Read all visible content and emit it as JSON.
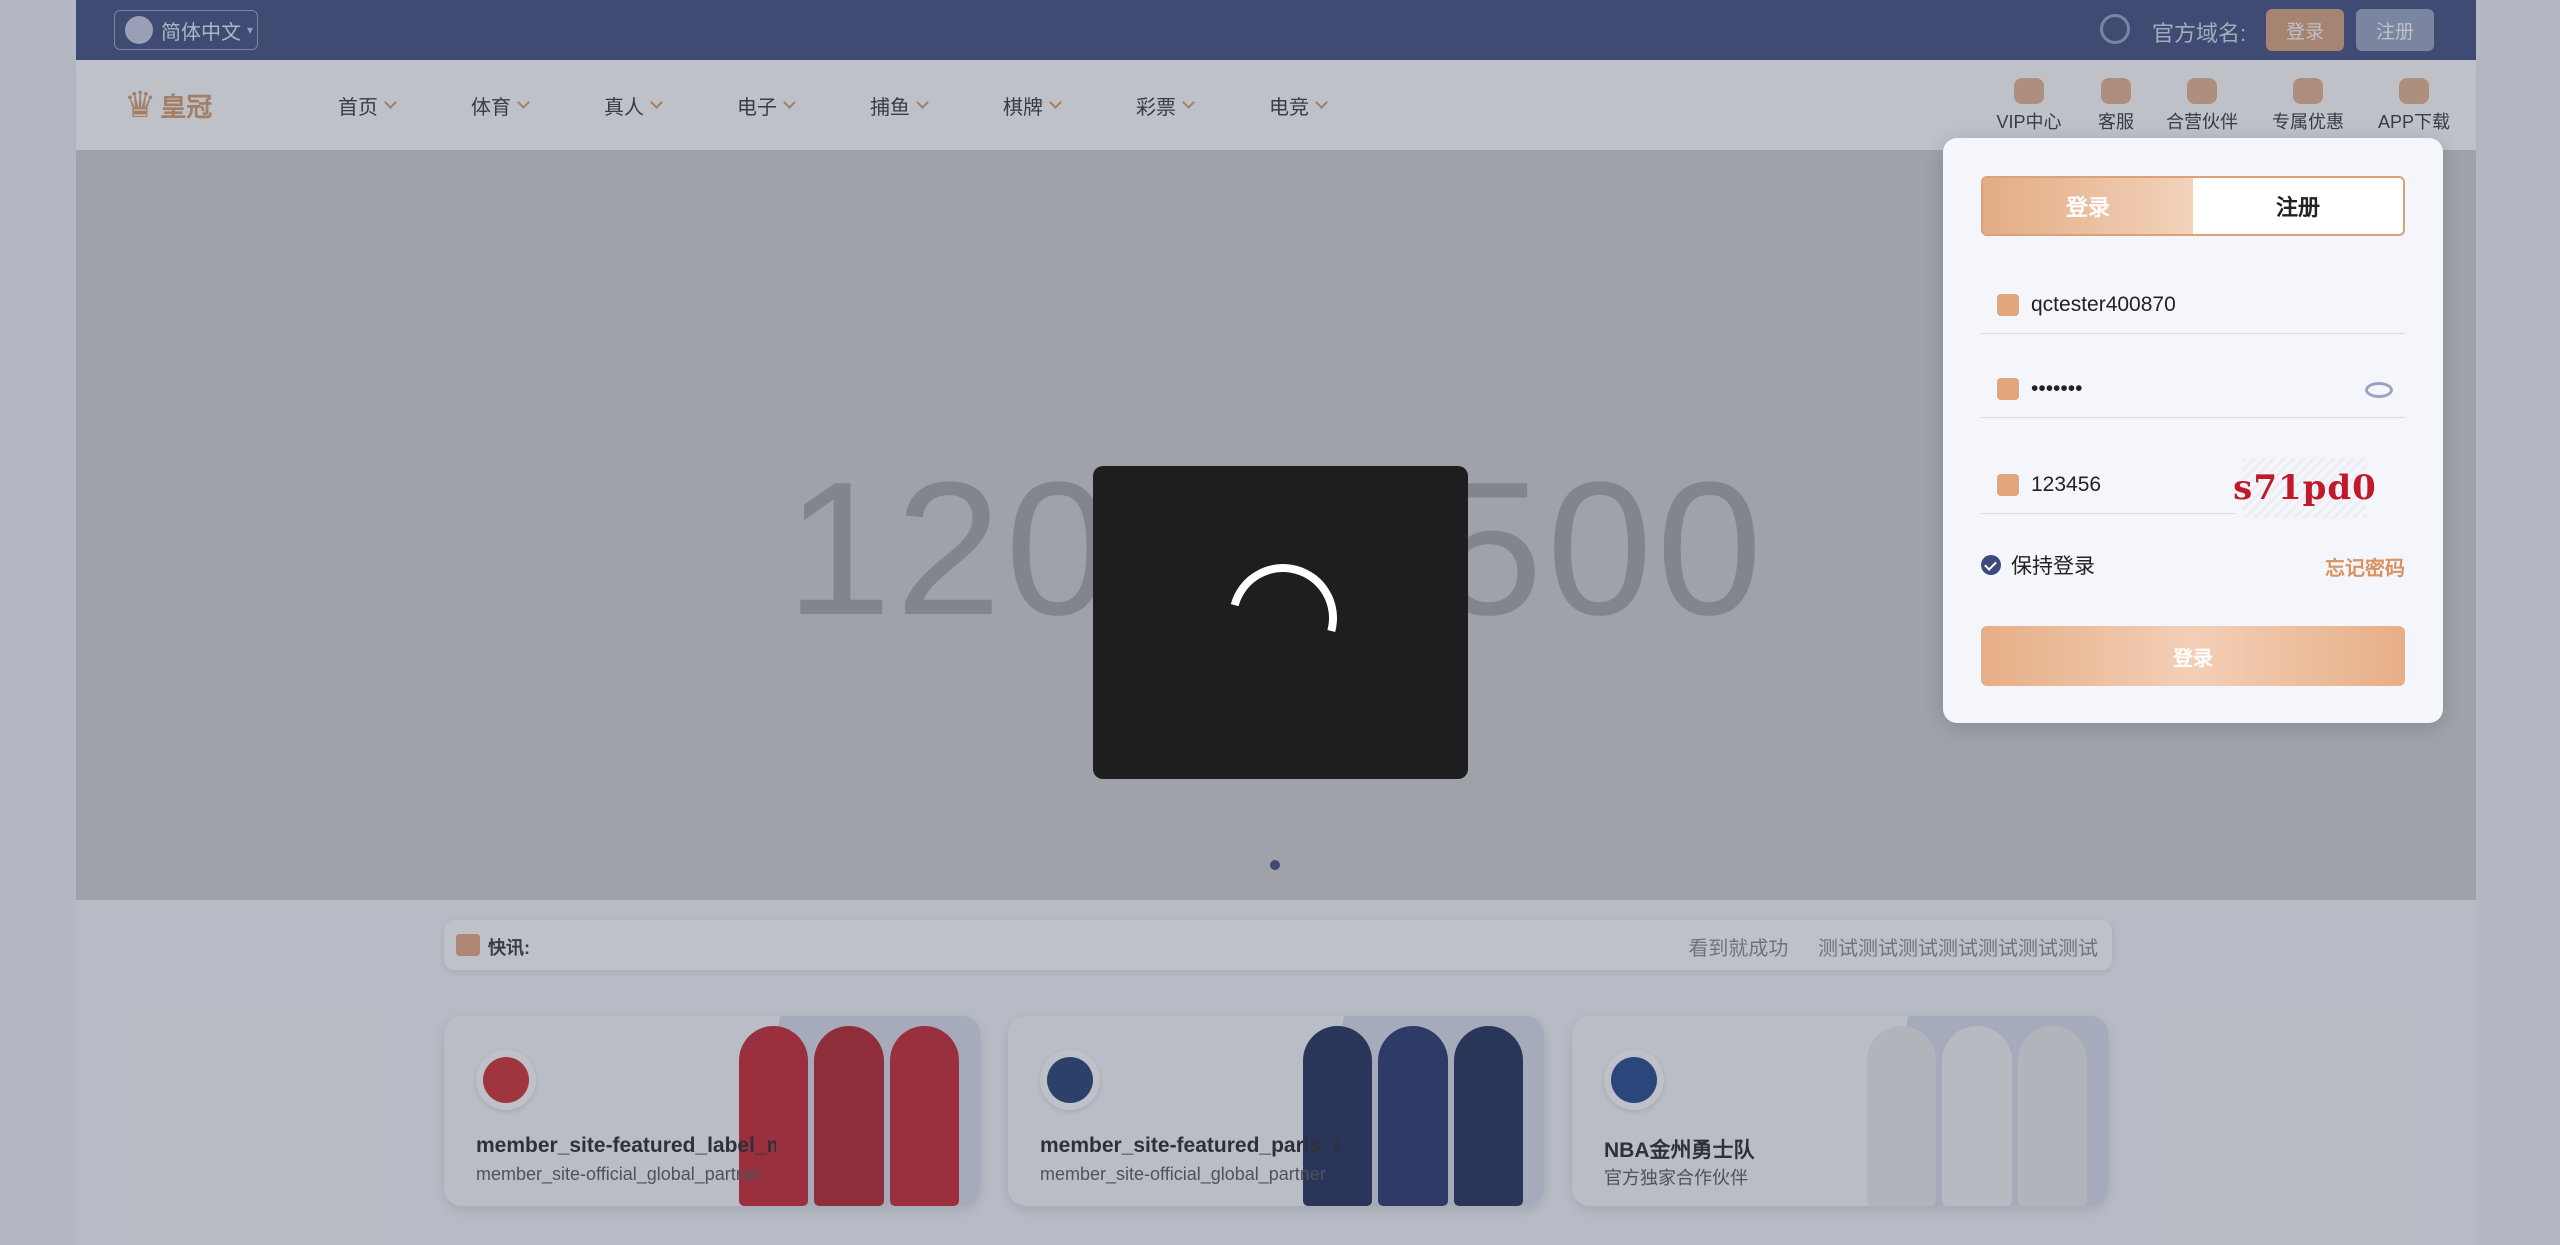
{
  "topbar": {
    "language": "简体中文",
    "domain_label": "官方域名:",
    "login_label": "登录",
    "register_label": "注册"
  },
  "nav": {
    "logo_text": "皇冠",
    "items": [
      {
        "label": "首页"
      },
      {
        "label": "体育"
      },
      {
        "label": "真人"
      },
      {
        "label": "电子"
      },
      {
        "label": "捕鱼"
      },
      {
        "label": "棋牌"
      },
      {
        "label": "彩票"
      },
      {
        "label": "电竞"
      }
    ],
    "quick_links": [
      {
        "label": "VIP中心",
        "icon": "vip-icon"
      },
      {
        "label": "客服",
        "icon": "customer-service-icon"
      },
      {
        "label": "合营伙伴",
        "icon": "partner-icon"
      },
      {
        "label": "专属优惠",
        "icon": "promo-icon"
      },
      {
        "label": "APP下载",
        "icon": "app-download-icon"
      }
    ]
  },
  "banner": {
    "placeholder_text": "1200 x 500"
  },
  "notice": {
    "label": "快讯:",
    "messages": [
      "看到就成功",
      "测试测试测试测试测试测试测试"
    ]
  },
  "cards": [
    {
      "title": "member_site-featured_label_manchester",
      "subtitle": "member_site-official_global_partner",
      "badge_color": "#d12a2a",
      "player_color": "#c8202a"
    },
    {
      "title": "member_site-featured_paris_saint_germain",
      "subtitle": "member_site-official_global_partner",
      "badge_color": "#1f3a6e",
      "player_color": "#1d2a55"
    },
    {
      "title": "NBA金州勇士队",
      "subtitle": "官方独家合作伙伴",
      "badge_color": "#1d428a",
      "player_color": "#f2f2f2"
    }
  ],
  "login_panel": {
    "tab_login": "登录",
    "tab_register": "注册",
    "username": "qctester400870",
    "password": "•••••••",
    "captcha_value": "123456",
    "captcha_image_text": "s71pd0",
    "remember_label": "保持登录",
    "forgot_label": "忘记密码",
    "submit_label": "登录"
  },
  "colors": {
    "accent": "#d9a27a",
    "topbar": "#3c4a7c",
    "captcha": "#c01a2a"
  }
}
